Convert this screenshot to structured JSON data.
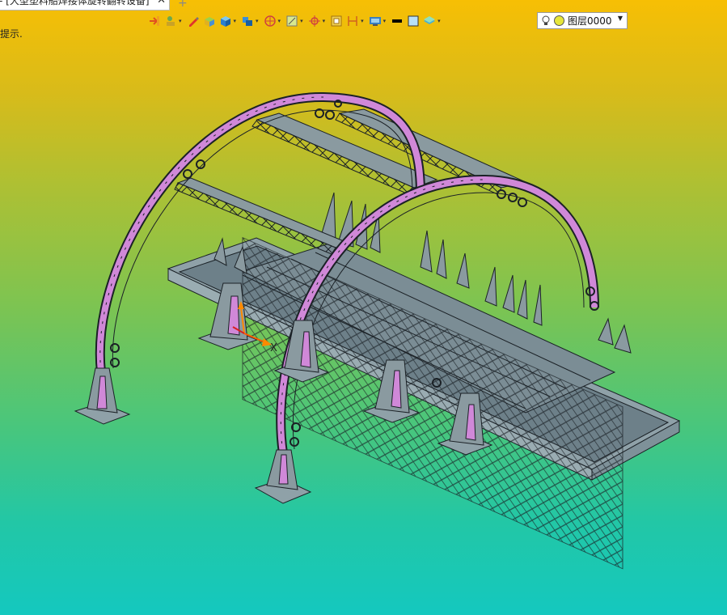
{
  "tab": {
    "title": "- [大型塑料船焊接体旋转翻转设备]",
    "close": "✕",
    "new_tab": "+"
  },
  "hint": "提示.",
  "toolbar": {
    "items": [
      {
        "icon": "import-icon",
        "dropdown": false
      },
      {
        "icon": "layer-tools-icon",
        "dropdown": true
      },
      {
        "icon": "pencil-icon",
        "dropdown": false
      },
      {
        "icon": "box-solid-icon",
        "dropdown": false
      },
      {
        "icon": "cube-icon",
        "dropdown": true
      },
      {
        "icon": "assembly-icon",
        "dropdown": true
      },
      {
        "icon": "section-view-icon",
        "dropdown": true
      },
      {
        "icon": "frame-view-icon",
        "dropdown": true
      },
      {
        "icon": "coordinate-icon",
        "dropdown": true
      },
      {
        "icon": "fit-view-icon",
        "dropdown": false
      },
      {
        "icon": "dimension-icon",
        "dropdown": true
      },
      {
        "icon": "display-mode-icon",
        "dropdown": true
      },
      {
        "icon": "line-color-icon",
        "dropdown": false
      },
      {
        "icon": "fill-color-icon",
        "dropdown": false
      },
      {
        "icon": "layer-stack-icon",
        "dropdown": true
      }
    ],
    "dropdown_glyph": "▾"
  },
  "layer_select": {
    "value": "图层0000",
    "arrow": "▼"
  },
  "axis_label": "X",
  "colors": {
    "frame": "#8a9aa0",
    "frame_dark": "#20262b",
    "arch": "#d088d8",
    "accent": "#ff5a00"
  }
}
